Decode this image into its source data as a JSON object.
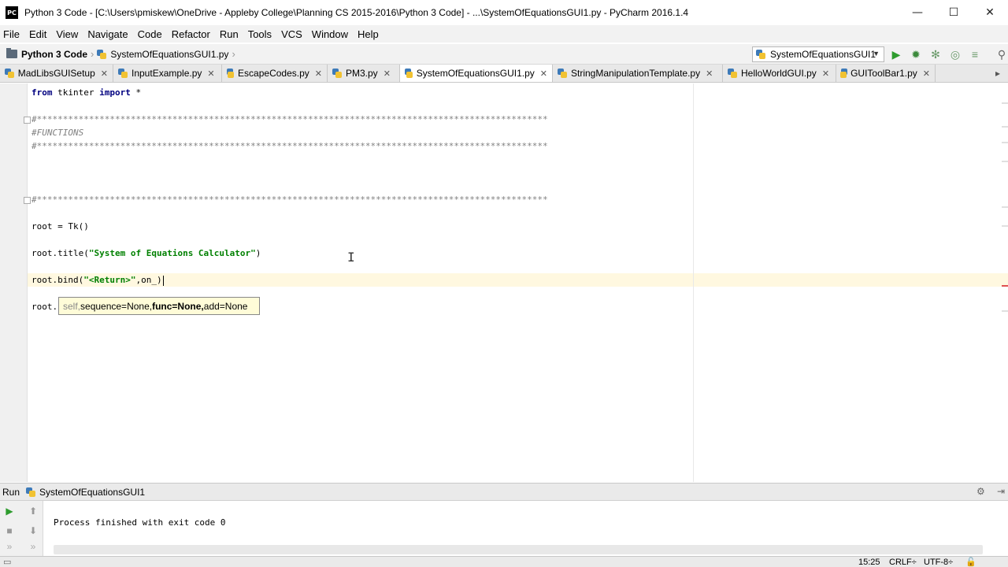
{
  "window": {
    "app_icon_text": "PC",
    "title": "Python 3 Code - [C:\\Users\\pmiskew\\OneDrive - Appleby College\\Planning CS 2015-2016\\Python 3 Code] - ...\\SystemOfEquationsGUI1.py - PyCharm 2016.1.4",
    "minimize": "—",
    "maximize": "☐",
    "close": "✕"
  },
  "menu": [
    "File",
    "Edit",
    "View",
    "Navigate",
    "Code",
    "Refactor",
    "Run",
    "Tools",
    "VCS",
    "Window",
    "Help"
  ],
  "navbar": {
    "project": "Python 3 Code",
    "file": "SystemOfEquationsGUI1.py",
    "run_config": "SystemOfEquationsGUI1"
  },
  "tabs": [
    {
      "label": "MadLibsGUISetup",
      "active": false
    },
    {
      "label": "InputExample.py",
      "active": false
    },
    {
      "label": "EscapeCodes.py",
      "active": false
    },
    {
      "label": "PM3.py",
      "active": false
    },
    {
      "label": "SystemOfEquationsGUI1.py",
      "active": true
    },
    {
      "label": "StringManipulationTemplate.py",
      "active": false
    },
    {
      "label": "HelloWorldGUI.py",
      "active": false
    },
    {
      "label": "GUIToolBar1.py",
      "active": false
    }
  ],
  "code": {
    "line_import_kw1": "from",
    "line_import_mod": " tkinter ",
    "line_import_kw2": "import",
    "line_import_star": " *",
    "stars": "#**************************************************************************************************",
    "functions_comment": "#FUNCTIONS",
    "root_tk": "root = Tk()",
    "title_prefix": "root.title(",
    "title_string": "\"System of Equations Calculator\"",
    "title_suffix": ")",
    "bind_prefix": "root.bind(",
    "bind_string": "\"<Return>\"",
    "bind_suffix": ",on_)",
    "last_line": "root."
  },
  "param_hint": {
    "self": "self,",
    "sequence": " sequence=None,",
    "func": " func=None,",
    "add": " add=None"
  },
  "run_panel": {
    "label": "Run",
    "config": "SystemOfEquationsGUI1",
    "output": "Process finished with exit code 0"
  },
  "status": {
    "position": "15:25",
    "line_sep": "CRLF÷",
    "encoding": "UTF-8÷"
  }
}
